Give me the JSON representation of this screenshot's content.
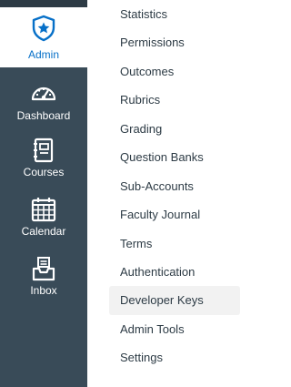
{
  "global_nav": {
    "admin": {
      "label": "Admin",
      "icon": "admin-shield-icon"
    },
    "items": [
      {
        "label": "Dashboard",
        "icon": "dashboard-icon"
      },
      {
        "label": "Courses",
        "icon": "courses-icon"
      },
      {
        "label": "Calendar",
        "icon": "calendar-icon"
      },
      {
        "label": "Inbox",
        "icon": "inbox-icon"
      }
    ]
  },
  "admin_tray": {
    "items": [
      {
        "label": "Statistics"
      },
      {
        "label": "Permissions"
      },
      {
        "label": "Outcomes"
      },
      {
        "label": "Rubrics"
      },
      {
        "label": "Grading"
      },
      {
        "label": "Question Banks"
      },
      {
        "label": "Sub-Accounts"
      },
      {
        "label": "Faculty Journal"
      },
      {
        "label": "Terms"
      },
      {
        "label": "Authentication"
      },
      {
        "label": "Developer Keys",
        "active": true
      },
      {
        "label": "Admin Tools"
      },
      {
        "label": "Settings"
      }
    ]
  },
  "colors": {
    "nav_background": "#394b58",
    "accent_blue": "#0770c8",
    "active_item_background": "#f2f2f2"
  }
}
